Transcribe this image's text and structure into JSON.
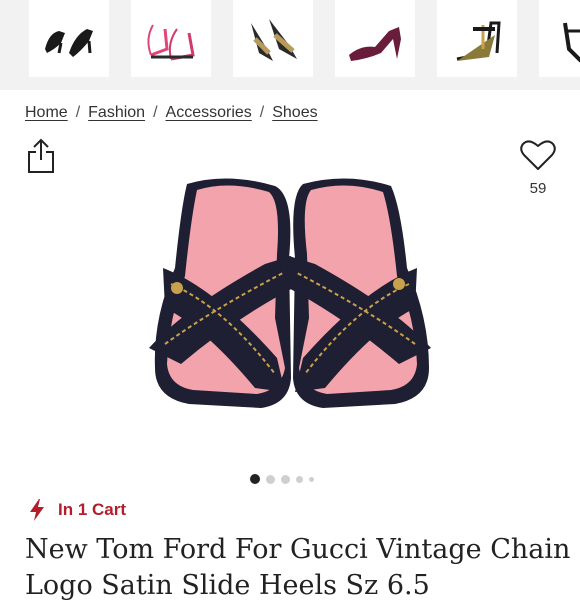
{
  "thumbnails": [
    {
      "name": "black-mule-sandal"
    },
    {
      "name": "pink-strappy-heel"
    },
    {
      "name": "printed-heel-sandal"
    },
    {
      "name": "burgundy-velvet-pump"
    },
    {
      "name": "gold-t-strap-sandal"
    },
    {
      "name": "black-heel-partial"
    }
  ],
  "breadcrumb": {
    "items": [
      "Home",
      "Fashion",
      "Accessories",
      "Shoes"
    ],
    "separator": "/"
  },
  "likes": {
    "count": "59"
  },
  "carousel": {
    "total_dots": 5,
    "active_index": 0
  },
  "cart_status": {
    "label": "In 1 Cart"
  },
  "product": {
    "title": "New Tom Ford For Gucci Vintage Chain Logo Satin Slide Heels Sz 6.5"
  },
  "colors": {
    "accent": "#b31d2c",
    "shoe_insole": "#f2a3ac",
    "shoe_strap": "#1f1f33",
    "chain_gold": "#c9a14a"
  },
  "icons": [
    "share-icon",
    "heart-icon",
    "bolt-icon"
  ]
}
